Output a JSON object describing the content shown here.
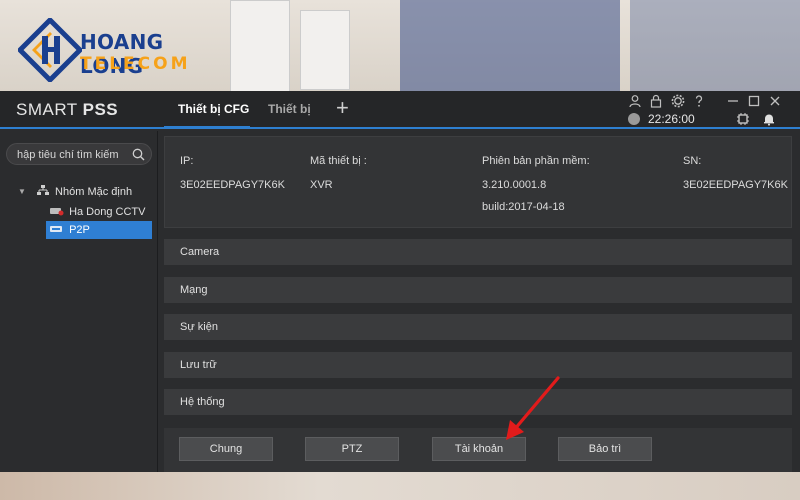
{
  "logo": {
    "line1": "HOANG LONG",
    "line2": "TELECOM"
  },
  "app": {
    "title_light": "SMART ",
    "title_bold": "PSS",
    "tabs": [
      {
        "label": "Thiết bị CFG",
        "active": true
      },
      {
        "label": "Thiết bị",
        "active": false
      }
    ],
    "add_tab_glyph": "+",
    "clock": "22:26:00"
  },
  "sidebar": {
    "search_placeholder": "hập tiêu chí tìm kiếm",
    "group": "Nhóm Mặc định",
    "devices": [
      {
        "label": "Ha Dong CCTV",
        "selected": false
      },
      {
        "label": "P2P",
        "selected": true
      }
    ]
  },
  "info": {
    "ip_label": "IP:",
    "ip_value": "3E02EEDPAGY7K6K",
    "model_label": "Mã thiết bị :",
    "model_value": "XVR",
    "fw_label": "Phiên bản phần mềm:",
    "fw_value": "3.210.0001.8",
    "build": "build:2017-04-18",
    "sn_label": "SN:",
    "sn_value": "3E02EEDPAGY7K6K"
  },
  "sections": [
    "Camera",
    "Mạng",
    "Sự kiện",
    "Lưu trữ",
    "Hệ thống"
  ],
  "buttons": [
    "Chung",
    "PTZ",
    "Tài khoản",
    "Bảo trì"
  ],
  "colors": {
    "accent": "#2e7fd0",
    "annotation": "#e21b1b",
    "logo_blue": "#1a3f8f",
    "logo_orange": "#f6a21a"
  }
}
